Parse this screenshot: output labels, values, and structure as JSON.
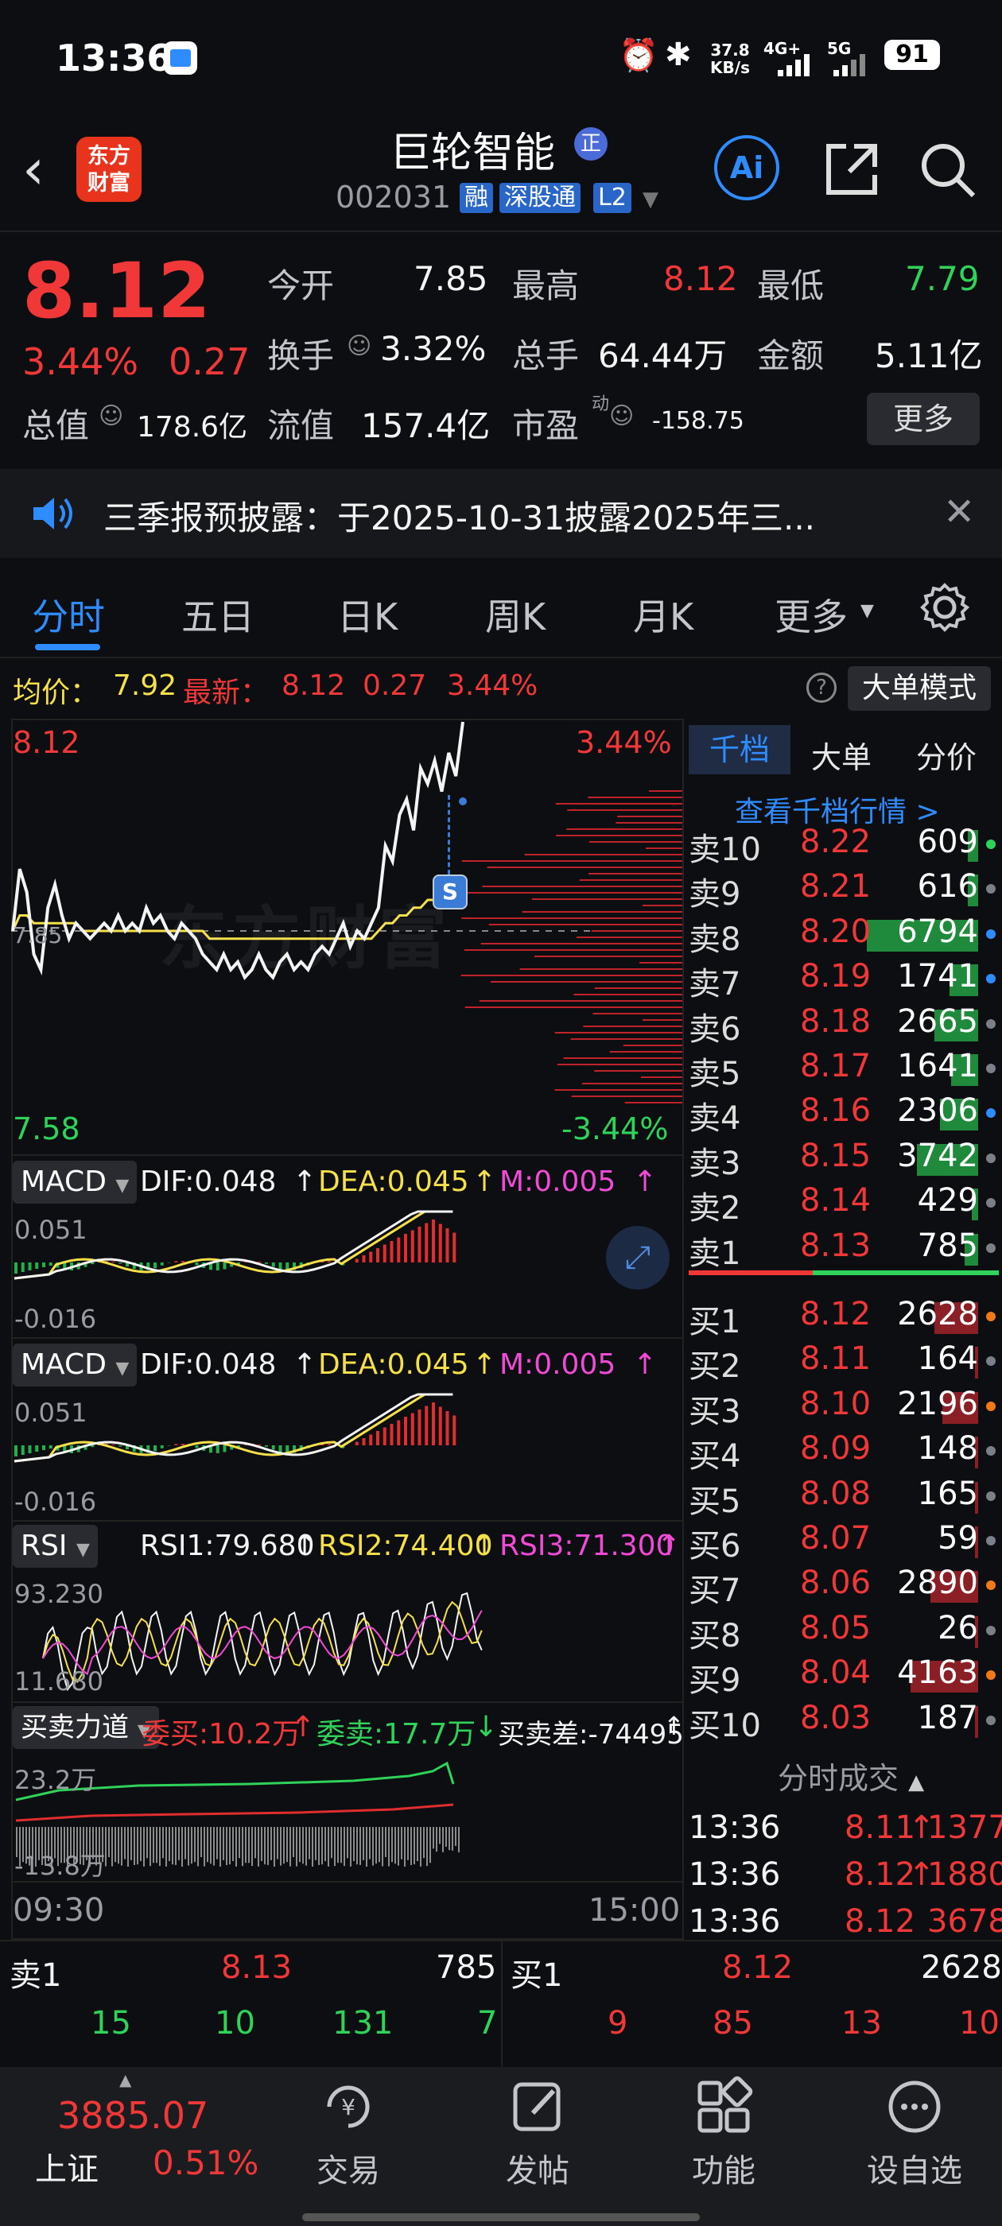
{
  "status_bar": {
    "time": "13:36",
    "net_speed": "37.8",
    "net_unit": "KB/s",
    "net_4g": "4G+",
    "net_5g": "5G",
    "battery": "91",
    "icons": [
      "app-icon",
      "alarm-icon",
      "bluetooth-icon",
      "signal-icon",
      "signal-icon",
      "battery-icon"
    ]
  },
  "header": {
    "logo_line1": "东方",
    "logo_line2": "财富",
    "stock_name": "巨轮智能",
    "stock_badge": "正",
    "stock_code": "002031",
    "tags": [
      "融",
      "深股通",
      "L2"
    ],
    "ai_label": "Ai"
  },
  "quote": {
    "price": "8.12",
    "change_pct": "3.44%",
    "change": "0.27",
    "open_label": "今开",
    "open": "7.85",
    "high_label": "最高",
    "high": "8.12",
    "low_label": "最低",
    "low": "7.79",
    "turnover_label": "换手",
    "turnover": "3.32%",
    "volume_label": "总手",
    "volume": "64.44万",
    "amount_label": "金额",
    "amount": "5.11亿",
    "mktcap_label": "总值",
    "mktcap": "178.6亿",
    "float_label": "流值",
    "float": "157.4亿",
    "pe_label": "市盈",
    "pe_sup": "动",
    "pe": "-158.75",
    "more_label": "更多"
  },
  "notice": {
    "text": "三季报预披露：于2025-10-31披露2025年三..."
  },
  "tabs": [
    "分时",
    "五日",
    "日K",
    "周K",
    "月K",
    "更多"
  ],
  "info_line": {
    "avg_label": "均价：",
    "avg": "7.92",
    "latest_label": "最新：",
    "latest": "8.12",
    "change": "0.27",
    "change_pct": "3.44%",
    "bigmode_label": "大单模式"
  },
  "chart": {
    "price_top": "8.12",
    "price_bottom": "7.58",
    "pct_top": "3.44%",
    "pct_bottom": "-3.44%",
    "prev_close_label": "7.85",
    "s_marker": "S",
    "watermark": "东方财富",
    "time_start": "09:30",
    "time_end": "15:00"
  },
  "indicators": {
    "macd1": {
      "name": "MACD",
      "dif": "DIF:0.048",
      "dea": "DEA:0.045",
      "m": "M:0.005",
      "top": "0.051",
      "bottom": "-0.016"
    },
    "macd2": {
      "name": "MACD",
      "dif": "DIF:0.048",
      "dea": "DEA:0.045",
      "m": "M:0.005",
      "top": "0.051",
      "bottom": "-0.016"
    },
    "rsi": {
      "name": "RSI",
      "rsi1": "RSI1:79.680",
      "rsi2": "RSI2:74.400",
      "rsi3": "RSI3:71.300",
      "top": "93.230",
      "bottom": "11.680"
    },
    "force": {
      "name": "买卖力道",
      "buy": "委买:10.2万",
      "sell": "委卖:17.7万",
      "diff": "买卖差:-74495",
      "top": "23.2万",
      "bottom": "-13.8万"
    }
  },
  "chart_data": {
    "type": "line",
    "title": "",
    "xlabel": "",
    "ylabel": "",
    "x": [
      "09:30",
      "15:00"
    ],
    "ylim": [
      7.58,
      8.12
    ],
    "prev_close": 7.85,
    "series": [],
    "intraday_price": [
      7.85,
      7.93,
      7.9,
      7.82,
      7.8,
      7.88,
      7.91,
      7.87,
      7.84,
      7.86,
      7.85,
      7.84,
      7.85,
      7.86,
      7.85,
      7.87,
      7.85,
      7.86,
      7.85,
      7.88,
      7.86,
      7.87,
      7.85,
      7.84,
      7.86,
      7.85,
      7.84,
      7.82,
      7.81,
      7.8,
      7.82,
      7.8,
      7.81,
      7.79,
      7.8,
      7.82,
      7.8,
      7.79,
      7.81,
      7.82,
      7.8,
      7.81,
      7.8,
      7.82,
      7.83,
      7.82,
      7.84,
      7.86,
      7.83,
      7.85,
      7.84,
      7.86,
      7.88,
      7.96,
      7.94,
      8.0,
      8.02,
      7.98,
      8.06,
      8.04,
      8.07,
      8.03,
      8.08,
      8.05,
      8.12
    ],
    "intraday_avg": [
      7.85,
      7.87,
      7.87,
      7.86,
      7.86,
      7.86,
      7.86,
      7.86,
      7.86,
      7.86,
      7.85,
      7.85,
      7.85,
      7.85,
      7.85,
      7.85,
      7.85,
      7.85,
      7.85,
      7.85,
      7.85,
      7.85,
      7.85,
      7.85,
      7.85,
      7.85,
      7.85,
      7.85,
      7.84,
      7.84,
      7.84,
      7.84,
      7.84,
      7.84,
      7.84,
      7.84,
      7.84,
      7.84,
      7.84,
      7.84,
      7.84,
      7.84,
      7.84,
      7.84,
      7.84,
      7.84,
      7.84,
      7.84,
      7.84,
      7.84,
      7.84,
      7.84,
      7.85,
      7.86,
      7.86,
      7.87,
      7.87,
      7.88,
      7.88,
      7.89,
      7.89,
      7.9,
      7.9,
      7.91,
      7.92
    ]
  },
  "order_book": {
    "tabs": [
      "千档",
      "大单",
      "分价"
    ],
    "view_more": "查看千档行情 >",
    "asks": [
      {
        "label": "卖10",
        "price": "8.22",
        "vol": "609",
        "ratio": 0.09,
        "dot": "#2fd35a"
      },
      {
        "label": "卖9",
        "price": "8.21",
        "vol": "616",
        "ratio": 0.09,
        "dot": "#7b7f88"
      },
      {
        "label": "卖8",
        "price": "8.20",
        "vol": "6794",
        "ratio": 1.0,
        "dot": "#2f8cff"
      },
      {
        "label": "卖7",
        "price": "8.19",
        "vol": "1741",
        "ratio": 0.26,
        "dot": "#2f8cff"
      },
      {
        "label": "卖6",
        "price": "8.18",
        "vol": "2665",
        "ratio": 0.39,
        "dot": "#7b7f88"
      },
      {
        "label": "卖5",
        "price": "8.17",
        "vol": "1641",
        "ratio": 0.24,
        "dot": "#7b7f88"
      },
      {
        "label": "卖4",
        "price": "8.16",
        "vol": "2306",
        "ratio": 0.34,
        "dot": "#2f8cff"
      },
      {
        "label": "卖3",
        "price": "8.15",
        "vol": "3742",
        "ratio": 0.55,
        "dot": "#7b7f88"
      },
      {
        "label": "卖2",
        "price": "8.14",
        "vol": "429",
        "ratio": 0.06,
        "dot": "#7b7f88"
      },
      {
        "label": "卖1",
        "price": "8.13",
        "vol": "785",
        "ratio": 0.12,
        "dot": "#7b7f88"
      }
    ],
    "bids": [
      {
        "label": "买1",
        "price": "8.12",
        "vol": "2628",
        "ratio": 0.39,
        "dot": "#f07a1a"
      },
      {
        "label": "买2",
        "price": "8.11",
        "vol": "164",
        "ratio": 0.03,
        "dot": "#7b7f88"
      },
      {
        "label": "买3",
        "price": "8.10",
        "vol": "2196",
        "ratio": 0.32,
        "dot": "#f07a1a"
      },
      {
        "label": "买4",
        "price": "8.09",
        "vol": "148",
        "ratio": 0.02,
        "dot": "#7b7f88"
      },
      {
        "label": "买5",
        "price": "8.08",
        "vol": "165",
        "ratio": 0.03,
        "dot": "#7b7f88"
      },
      {
        "label": "买6",
        "price": "8.07",
        "vol": "59",
        "ratio": 0.01,
        "dot": "#7b7f88"
      },
      {
        "label": "买7",
        "price": "8.06",
        "vol": "2890",
        "ratio": 0.43,
        "dot": "#f07a1a"
      },
      {
        "label": "买8",
        "price": "8.05",
        "vol": "26",
        "ratio": 0.01,
        "dot": "#7b7f88"
      },
      {
        "label": "买9",
        "price": "8.04",
        "vol": "4163",
        "ratio": 0.61,
        "dot": "#f07a1a"
      },
      {
        "label": "买10",
        "price": "8.03",
        "vol": "187",
        "ratio": 0.03,
        "dot": "#7b7f88"
      }
    ]
  },
  "trades": {
    "title": "分时成交",
    "rows": [
      {
        "time": "13:36",
        "price": "8.11",
        "arrow": "↑",
        "vol": "1377"
      },
      {
        "time": "13:36",
        "price": "8.12",
        "arrow": "↑",
        "vol": "1880"
      },
      {
        "time": "13:36",
        "price": "8.12",
        "arrow": "",
        "vol": "3678"
      }
    ]
  },
  "bottom_quote": {
    "sell_label": "卖1",
    "sell_price": "8.13",
    "sell_vol": "785",
    "buy_label": "买1",
    "buy_price": "8.12",
    "buy_vol": "2628",
    "sell_row": [
      "15",
      "10",
      "131",
      "7"
    ],
    "buy_row": [
      "9",
      "85",
      "13",
      "10"
    ]
  },
  "nav": {
    "index_value": "3885.07",
    "index_name": "上证",
    "index_pct": "0.51%",
    "items": [
      "交易",
      "发帖",
      "功能",
      "设自选"
    ]
  }
}
